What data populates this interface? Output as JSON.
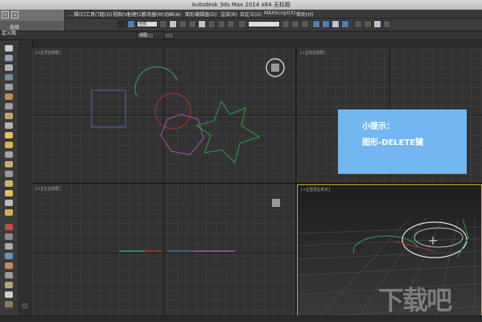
{
  "window": {
    "title": "Autodesk 3ds Max  2014 x64    无标题"
  },
  "menubar": {
    "items": [
      {
        "label": "...辑(E)"
      },
      {
        "label": "工具(T)"
      },
      {
        "label": "组(G)"
      },
      {
        "label": "视图(V)"
      },
      {
        "label": "创建(C)"
      },
      {
        "label": "修改器(M)"
      },
      {
        "label": "动画(A)"
      },
      {
        "label": "图形编辑器(D)"
      },
      {
        "label": "渲染(R)"
      },
      {
        "label": "自定义(U)"
      },
      {
        "label": "MAXScript(X)"
      },
      {
        "label": "帮助(H)"
      }
    ]
  },
  "toolbar": {
    "selection_filter": "全部",
    "named_selection": "",
    "view_dropdown": "视图"
  },
  "popover": {
    "line1": "选择",
    "line2": "定义观"
  },
  "viewports": {
    "top": {
      "label": "[+][顶][线框]"
    },
    "front": {
      "label": "[+][前][线框]"
    },
    "left": {
      "label": "[+][左][线框]"
    },
    "perspective": {
      "label": "[+][透视][真实]"
    }
  },
  "hint": {
    "title": "小提示：",
    "text": "图形-DELETE键"
  },
  "watermark": {
    "text": "下载吧"
  },
  "colors": {
    "accent_hint": "#73b7f0",
    "active_viewport_border": "#c9a442",
    "toolbar_blue": "#4a7fb3"
  }
}
